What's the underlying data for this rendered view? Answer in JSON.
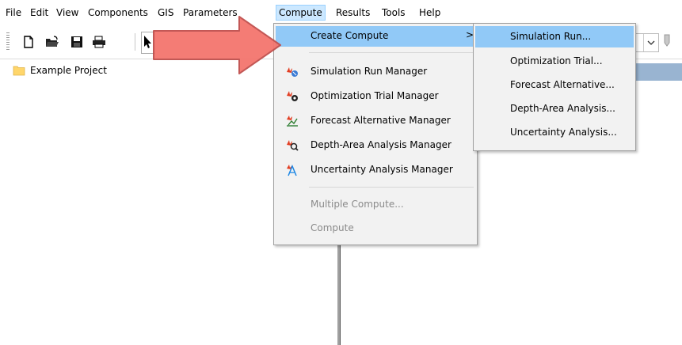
{
  "menubar": {
    "items": [
      "File",
      "Edit",
      "View",
      "Components",
      "GIS",
      "Parameters",
      "Compute",
      "Results",
      "Tools",
      "Help"
    ],
    "active": "Compute"
  },
  "toolbar": {
    "buttons": [
      "new-document-icon",
      "open-folder-icon",
      "save-icon",
      "print-icon",
      "pointer-icon"
    ]
  },
  "tree": {
    "items": [
      {
        "label": "Example Project",
        "icon": "folder-icon"
      }
    ]
  },
  "compute_menu": {
    "create_compute": {
      "label": "Create Compute",
      "chevron": ">"
    },
    "managers": [
      {
        "label": "Simulation Run Manager",
        "icon": "simulation-run-manager-icon"
      },
      {
        "label": "Optimization Trial Manager",
        "icon": "optimization-trial-manager-icon"
      },
      {
        "label": "Forecast Alternative Manager",
        "icon": "forecast-alternative-manager-icon"
      },
      {
        "label": "Depth-Area Analysis Manager",
        "icon": "depth-area-analysis-manager-icon"
      },
      {
        "label": "Uncertainty Analysis Manager",
        "icon": "uncertainty-analysis-manager-icon"
      }
    ],
    "disabled_items": [
      {
        "label": "Multiple Compute..."
      },
      {
        "label": "Compute"
      }
    ]
  },
  "create_compute_submenu": {
    "items": [
      {
        "label": "Simulation Run...",
        "highlighted": true
      },
      {
        "label": "Optimization Trial..."
      },
      {
        "label": "Forecast Alternative..."
      },
      {
        "label": "Depth-Area Analysis..."
      },
      {
        "label": "Uncertainty Analysis..."
      }
    ]
  },
  "colors": {
    "highlight": "#91c9f7",
    "menu_bg": "#f2f2f2",
    "arrow_fill": "#f4756e",
    "arrow_stroke": "#c0504d"
  }
}
